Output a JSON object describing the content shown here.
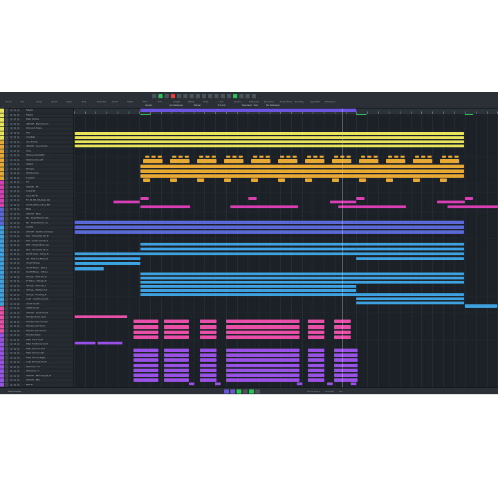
{
  "colors": {
    "background": "#1d2328",
    "yellow": "#e8e35a",
    "orange": "#e8a834",
    "magenta": "#d93fb4",
    "blue": "#5b69d8",
    "cyan": "#3ea2e0",
    "pink": "#e84fa8",
    "purple": "#9a52e6",
    "green": "#2fbf5a"
  },
  "tracks": [
    {
      "name": "Master",
      "color": "#e8e35a"
    },
    {
      "name": "Marker",
      "color": "#e8e35a"
    },
    {
      "name": "Main Drums",
      "color": "#e8e35a"
    },
    {
      "name": "GROUP - Main Drums",
      "color": "#e8e35a"
    },
    {
      "name": "Kick and Snare",
      "color": "#e8e35a"
    },
    {
      "name": "Tom",
      "color": "#e8e35a"
    },
    {
      "name": "Cymbals",
      "color": "#e8e35a"
    },
    {
      "name": "Aux Drums",
      "color": "#e8a834"
    },
    {
      "name": "GROUP - Aux Drums",
      "color": "#e8a834"
    },
    {
      "name": "Clap",
      "color": "#e8a834"
    },
    {
      "name": "Tambourine Right",
      "color": "#e8a834"
    },
    {
      "name": "Tambourine Left",
      "color": "#e8a834"
    },
    {
      "name": "Shaker",
      "color": "#e8a834"
    },
    {
      "name": "Bongos",
      "color": "#e8a834"
    },
    {
      "name": "Tambourine",
      "color": "#e8a834"
    },
    {
      "name": "Cowbell",
      "color": "#e8a834"
    },
    {
      "name": "FX",
      "color": "#d93fb4"
    },
    {
      "name": "GROUP - FX",
      "color": "#d93fb4"
    },
    {
      "name": "Crash FX",
      "color": "#d93fb4"
    },
    {
      "name": "Clap FX Hit",
      "color": "#d93fb4"
    },
    {
      "name": "FX 01_Hit_08_Riser_LR",
      "color": "#d93fb4"
    },
    {
      "name": "Synth_Water_Cave_MO",
      "color": "#d93fb4"
    },
    {
      "name": "Bass",
      "color": "#5b69d8"
    },
    {
      "name": "GROUP - Bass",
      "color": "#5b69d8"
    },
    {
      "name": "BA - Multi Electric (R)",
      "color": "#5b69d8"
    },
    {
      "name": "BA - Multi Electric (L)",
      "color": "#5b69d8"
    },
    {
      "name": "Synths",
      "color": "#3ea2e0"
    },
    {
      "name": "GROUP - Synths and Keys",
      "color": "#3ea2e0"
    },
    {
      "name": "Pad - Threshold Str_R",
      "color": "#3ea2e0"
    },
    {
      "name": "Pad - Synth Chords 1",
      "color": "#3ea2e0"
    },
    {
      "name": "KEY - Honky Bonk_rev",
      "color": "#3ea2e0"
    },
    {
      "name": "Pad - Threshold Str_L",
      "color": "#3ea2e0"
    },
    {
      "name": "Synth Lead - Arrow_R",
      "color": "#3ea2e0"
    },
    {
      "name": "AR - Retrace Brass_R",
      "color": "#3ea2e0"
    },
    {
      "name": "Vocal Strings",
      "color": "#3ea2e0"
    },
    {
      "name": "Synth Brass - Real_L",
      "color": "#3ea2e0"
    },
    {
      "name": "Synth Brass - Ultra_L",
      "color": "#3ea2e0"
    },
    {
      "name": "Strings - Malo Str_R",
      "color": "#3ea2e0"
    },
    {
      "name": "Pr Piano - Strings_R",
      "color": "#3ea2e0"
    },
    {
      "name": "Strings - Malo Str_L",
      "color": "#3ea2e0"
    },
    {
      "name": "Strings - Mellow S_R",
      "color": "#3ea2e0"
    },
    {
      "name": "Strings - Floating_R",
      "color": "#3ea2e0"
    },
    {
      "name": "Lead - Custom Lav_R",
      "color": "#3ea2e0"
    },
    {
      "name": "Guitar Synth",
      "color": "#3ea2e0"
    },
    {
      "name": "LEAD Vocals",
      "color": "#e84fa8"
    },
    {
      "name": "GROUP - Lead Vocals",
      "color": "#e84fa8"
    },
    {
      "name": "Female Vocal Lead",
      "color": "#e84fa8"
    },
    {
      "name": "Female Chorus Lead",
      "color": "#e84fa8"
    },
    {
      "name": "Female Lead Vox L",
      "color": "#e84fa8"
    },
    {
      "name": "Female Lead Vox R",
      "color": "#e84fa8"
    },
    {
      "name": "Female Notes",
      "color": "#9a52e6"
    },
    {
      "name": "Male Vocal Lead",
      "color": "#9a52e6"
    },
    {
      "name": "Male Fractional Lead",
      "color": "#9a52e6"
    },
    {
      "name": "Male Chorus Lead",
      "color": "#9a52e6"
    },
    {
      "name": "Male Chorus Left",
      "color": "#9a52e6"
    },
    {
      "name": "Male Chorus Right",
      "color": "#9a52e6"
    },
    {
      "name": "Lead Rhodoid Vocal",
      "color": "#9a52e6"
    },
    {
      "name": "Harmony 1 R",
      "color": "#9a52e6"
    },
    {
      "name": "Harmony 1 L",
      "color": "#9a52e6"
    },
    {
      "name": "GROUP - BSS Song N_ta",
      "color": "#9a52e6"
    },
    {
      "name": "GROUP - BSS",
      "color": "#9a52e6"
    },
    {
      "name": "BSS N",
      "color": "#9a52e6"
    }
  ],
  "toolbar": {
    "labels": [
      "Touch",
      "Dry",
      "Active",
      "Glued",
      "Snap",
      "Grid",
      "Quantize",
      "Zoom",
      "Scale",
      "Start",
      "End",
      "Length",
      "Offset",
      "Mute",
      "Lock",
      "Volume",
      "Transpose",
      "Fine-Tune",
      "Global Trans",
      "Root Key",
      "Algorithm",
      "Extension"
    ],
    "values": [
      "Global",
      "All Instances",
      "Marker",
      "8:4:4:0",
      "Standard - Solo",
      "No Extension"
    ]
  },
  "transport": {
    "left_label": "Mixer Panels",
    "time_display": "00:52:14:03",
    "tempo": "122.000",
    "signature": "4/4"
  }
}
